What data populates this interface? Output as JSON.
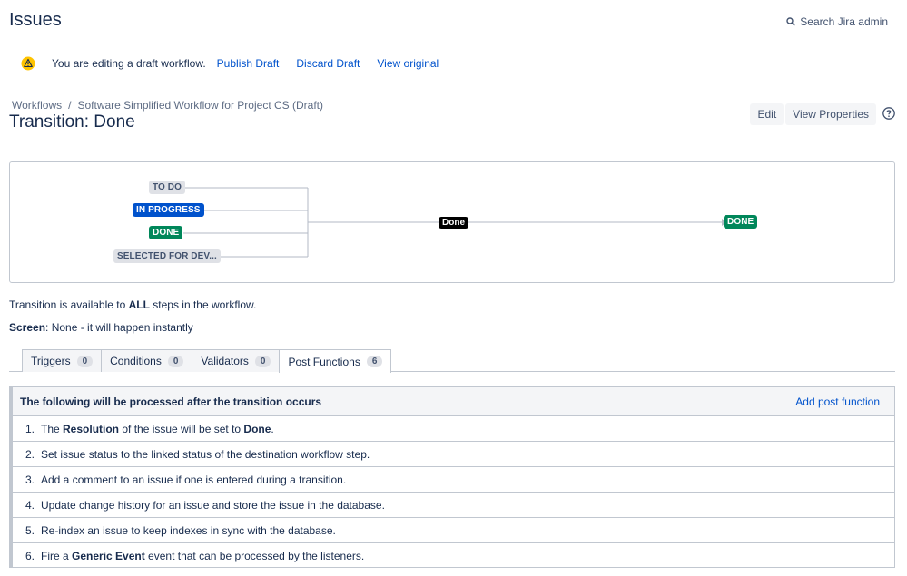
{
  "header": {
    "title": "Issues",
    "search_label": "Search Jira admin"
  },
  "draft_banner": {
    "message": "You are editing a draft workflow.",
    "publish": "Publish Draft",
    "discard": "Discard Draft",
    "view_original": "View original"
  },
  "breadcrumb": {
    "workflows": "Workflows",
    "separator": "/",
    "current": "Software Simplified Workflow for Project CS (Draft)"
  },
  "page": {
    "title": "Transition: Done",
    "edit": "Edit",
    "view_properties": "View Properties"
  },
  "diagram": {
    "source_statuses": [
      "TO DO",
      "IN PROGRESS",
      "DONE",
      "SELECTED FOR DEV..."
    ],
    "transition_label": "Done",
    "target_status": "DONE",
    "colors": {
      "todo": "#dfe1e6",
      "in_progress": "#0052cc",
      "done": "#00875a"
    }
  },
  "info": {
    "avail_pre": "Transition is available to ",
    "avail_bold": "ALL",
    "avail_post": " steps in the workflow.",
    "screen_label": "Screen",
    "screen_value": ": None - it will happen instantly"
  },
  "tabs": [
    {
      "label": "Triggers",
      "count": "0"
    },
    {
      "label": "Conditions",
      "count": "0"
    },
    {
      "label": "Validators",
      "count": "0"
    },
    {
      "label": "Post Functions",
      "count": "6"
    }
  ],
  "post_functions": {
    "header": "The following will be processed after the transition occurs",
    "add_label": "Add post function",
    "items": [
      {
        "num": "1.",
        "pre": "The ",
        "b1": "Resolution",
        "mid": " of the issue will be set to ",
        "b2": "Done",
        "post": "."
      },
      {
        "num": "2.",
        "pre": "Set issue status to the linked status of the destination workflow step.",
        "b1": "",
        "mid": "",
        "b2": "",
        "post": ""
      },
      {
        "num": "3.",
        "pre": "Add a comment to an issue if one is entered during a transition.",
        "b1": "",
        "mid": "",
        "b2": "",
        "post": ""
      },
      {
        "num": "4.",
        "pre": "Update change history for an issue and store the issue in the database.",
        "b1": "",
        "mid": "",
        "b2": "",
        "post": ""
      },
      {
        "num": "5.",
        "pre": "Re-index an issue to keep indexes in sync with the database.",
        "b1": "",
        "mid": "",
        "b2": "",
        "post": ""
      },
      {
        "num": "6.",
        "pre": "Fire a ",
        "b1": "Generic Event",
        "mid": " event that can be processed by the listeners.",
        "b2": "",
        "post": ""
      }
    ]
  }
}
